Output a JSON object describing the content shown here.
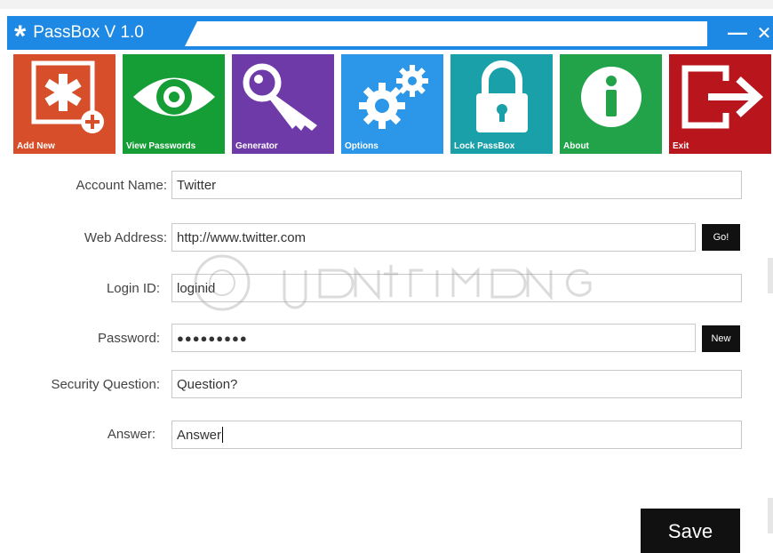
{
  "window": {
    "title": "PassBox V 1.0",
    "minimize_glyph": "—",
    "close_glyph": "✕"
  },
  "tiles": [
    {
      "label": "Add New",
      "color": "#d64f2a",
      "icon": "asterisk-plus-icon"
    },
    {
      "label": "View Passwords",
      "color": "#159e36",
      "icon": "eye-icon"
    },
    {
      "label": "Generator",
      "color": "#6d3aa8",
      "icon": "key-icon"
    },
    {
      "label": "Options",
      "color": "#2c97e8",
      "icon": "gears-icon"
    },
    {
      "label": "Lock PassBox",
      "color": "#1aa0a8",
      "icon": "padlock-icon"
    },
    {
      "label": "About",
      "color": "#22a34a",
      "icon": "info-icon"
    },
    {
      "label": "Exit",
      "color": "#b8151d",
      "icon": "exit-icon"
    }
  ],
  "form": {
    "account_name": {
      "label": "Account Name:",
      "value": "Twitter"
    },
    "web_address": {
      "label": "Web Address:",
      "value": "http://www.twitter.com",
      "button": "Go!"
    },
    "login_id": {
      "label": "Login ID:",
      "value": "loginid"
    },
    "password": {
      "label": "Password:",
      "value": "●●●●●●●●●",
      "button": "New"
    },
    "security_question": {
      "label": "Security Question:",
      "value": "Question?"
    },
    "answer": {
      "label": "Answer:",
      "value": "Answer"
    }
  },
  "save_label": "Save",
  "colors": {
    "titlebar": "#1e88e5",
    "button_black": "#111111"
  }
}
